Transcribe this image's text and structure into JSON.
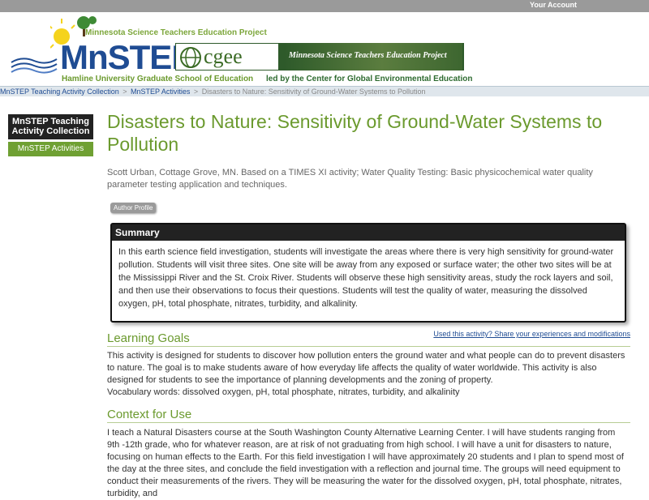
{
  "topbar": {
    "account_label": "Your Account"
  },
  "banner": {
    "mnstep_tagline": "Minnesota Science Teachers Education Project",
    "mnstep_logo_text": "MnSTEP",
    "hamline_text": "Hamline University Graduate School of Education",
    "cgee_logo_text": "cgee",
    "cgee_tagline": "Minnesota Science Teachers Education Project",
    "led_by_text": "led by the Center for Global Environmental Education"
  },
  "breadcrumb": {
    "items": [
      "MnSTEP Teaching Activity Collection",
      "MnSTEP Activities",
      "Disasters to Nature: Sensitivity of Ground-Water Systems to Pollution"
    ],
    "separator": ">"
  },
  "sidebar": {
    "title": "MnSTEP Teaching Activity Collection",
    "subtitle": "MnSTEP Activities"
  },
  "page": {
    "title": "Disasters to Nature: Sensitivity of Ground-Water Systems to Pollution",
    "byline": "Scott Urban, Cottage Grove, MN. Based on a TIMES XI activity; Water Quality Testing: Basic physicochemical water quality parameter testing application and techniques.",
    "author_profile_label": "Author Profile"
  },
  "summary": {
    "heading": "Summary",
    "body": "In this earth science field investigation, students will investigate the areas where there is very high sensitivity for ground-water pollution. Students will visit three sites. One site will be away from any exposed or surface water; the other two sites will be at the Mississippi River and the St. Croix River. Students will observe these high sensitivity areas, study the rock layers and soil, and then use their observations to focus their questions. Students will test the quality of water, measuring the dissolved oxygen, pH, total phosphate, nitrates, turbidity, and alkalinity."
  },
  "share_link": "Used this activity? Share your experiences and modifications",
  "learning_goals": {
    "heading": "Learning Goals",
    "body": "This activity is designed for students to discover how pollution enters the ground water and what people can do to prevent disasters to nature. The goal is to make students aware of how everyday life affects the quality of water worldwide. This activity is also designed for students to see the importance of planning developments and the zoning of property.",
    "vocab": "Vocabulary words: dissolved oxygen, pH, total phosphate, nitrates, turbidity, and alkalinity"
  },
  "context": {
    "heading": "Context for Use",
    "body": "I teach a Natural Disasters course at the South Washington County Alternative Learning Center. I will have students ranging from 9th -12th grade, who for whatever reason, are at risk of not graduating from high school. I will have a unit for disasters to nature, focusing on human effects to the Earth. For this field investigation I will have approximately 20 students and I plan to spend most of the day at the three sites, and conclude the field investigation with a reflection and journal time. The groups will need equipment to conduct their measurements of the rivers. They will be measuring the water for the dissolved oxygen, pH, total phosphate, nitrates, turbidity, and"
  },
  "colors": {
    "brand_green": "#6b9a2e",
    "brand_blue": "#1f4c93",
    "topbar_gray": "#9a9a9a",
    "dark": "#222222"
  }
}
